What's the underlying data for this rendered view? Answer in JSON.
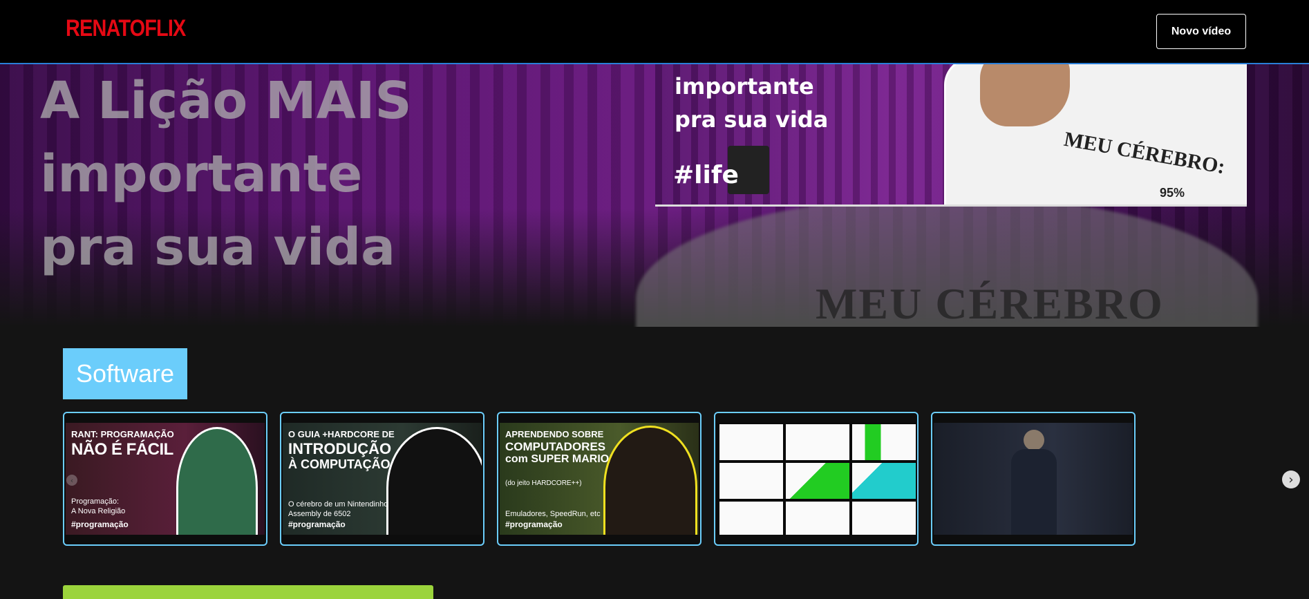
{
  "header": {
    "logo": "RENATOFLIX",
    "new_video_label": "Novo vídeo"
  },
  "banner": {
    "title_lines": [
      "A Lição MAIS",
      "importante",
      "pra sua vida"
    ],
    "player": {
      "text_lines": [
        "importante",
        "pra sua vida"
      ],
      "tag": "#life",
      "shirt_text": "MEU CÉREBRO:",
      "shirt_percent": "95%"
    },
    "bg_shirt_text": "MEU CÉREBRO"
  },
  "category": {
    "title": "Software",
    "color": "#6bcdfb",
    "cards": [
      {
        "line1": "RANT: PROGRAMAÇÃO",
        "line2": "NÃO É FÁCIL",
        "sub": "Programação:",
        "sub2": "A Nova Religião",
        "tag": "#programação"
      },
      {
        "line1": "O GUIA +HARDCORE DE",
        "line2": "INTRODUÇÃO",
        "line3": "À COMPUTAÇÃO",
        "sub": "O cérebro de um Nintendinho (",
        "sub2": "Assembly de 6502",
        "tag": "#programação"
      },
      {
        "line1": "APRENDENDO SOBRE",
        "line2": "COMPUTADORES",
        "line3": "com SUPER MARIO!",
        "sub": "(do jeito HARDCORE++)",
        "sub2": "Emuladores, SpeedRun, etc",
        "tag": "#programação"
      },
      {
        "kind": "sorting-charts"
      },
      {
        "kind": "lecture"
      }
    ]
  },
  "icons": {
    "next": "chevron-right-icon",
    "prev": "chevron-left-icon"
  }
}
